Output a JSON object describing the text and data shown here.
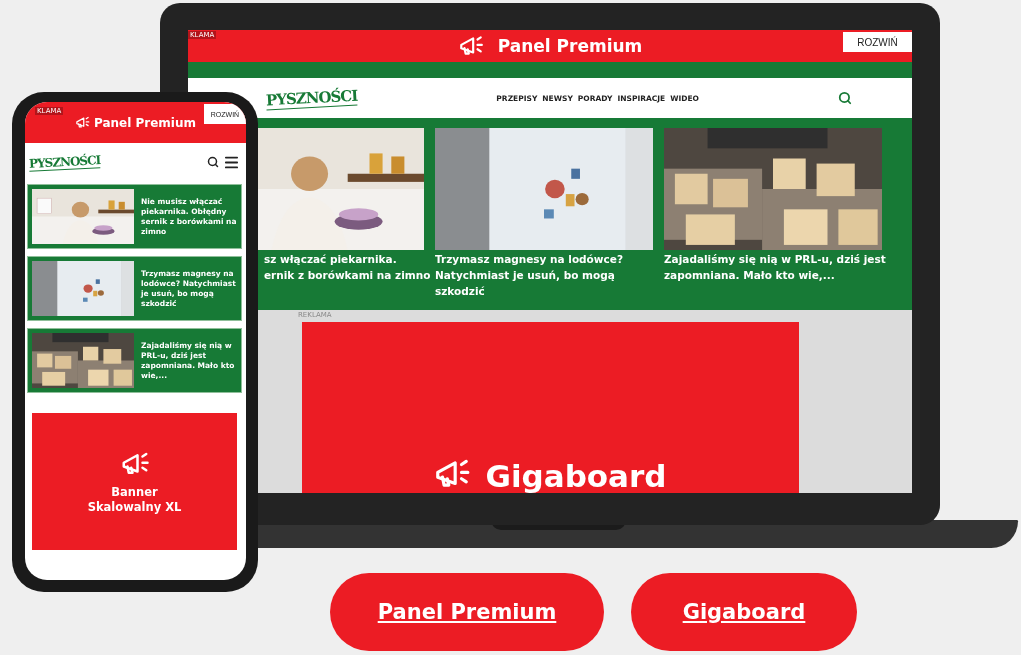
{
  "laptop": {
    "ad_bar": {
      "label": "KLAMA",
      "title": "Panel Premium",
      "button": "ROZWIŃ"
    },
    "nav": {
      "logo": "PYSZNOŚCI",
      "menu": [
        "PRZEPISY",
        "NEWSY",
        "PORADY",
        "INSPIRACJE",
        "WIDEO"
      ]
    },
    "articles": [
      {
        "caption_lines": [
          "sz włączać piekarnika.",
          "ernik z borówkami na zimno"
        ]
      },
      {
        "caption_lines": [
          "Trzymasz magnesy na lodówce?",
          "Natychmiast je usuń, bo mogą",
          "szkodzić"
        ]
      },
      {
        "caption_lines": [
          "Zajadaliśmy się nią w PRL-u, dziś jest",
          "zapomniana. Mało kto wie,..."
        ]
      }
    ],
    "ad": {
      "label": "REKLAMA",
      "title": "Gigaboard"
    }
  },
  "phone": {
    "ad_bar": {
      "label": "KLAMA",
      "title": "Panel Premium",
      "button": "ROZWIŃ"
    },
    "logo": "PYSZNOŚCI",
    "articles": [
      {
        "caption": "Nie musisz włączać piekarnika. Obłędny sernik z borówkami na zimno"
      },
      {
        "caption": "Trzymasz magnesy na lodówce? Natychmiast je usuń, bo mogą szkodzić"
      },
      {
        "caption": "Zajadaliśmy się nią w PRL-u, dziś jest zapomniana. Mało kto wie,..."
      }
    ],
    "banner": {
      "title": "Banner Skalowalny XL"
    }
  },
  "buttons": [
    "Panel Premium",
    "Gigaboard"
  ]
}
